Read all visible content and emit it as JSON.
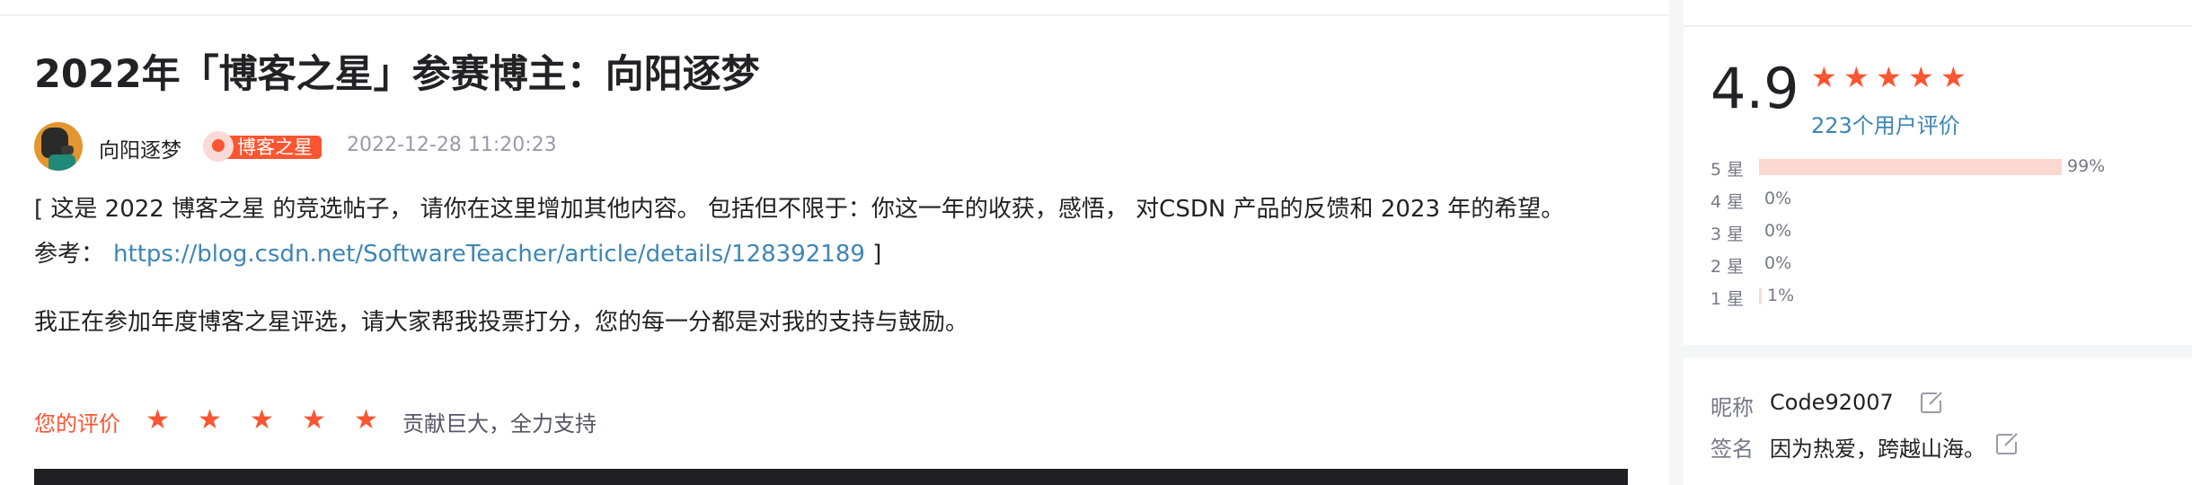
{
  "post": {
    "title": "2022年「博客之星」参赛博主：向阳逐梦",
    "author": "向阳逐梦",
    "badge": "博客之星",
    "date": "2022-12-28 11:20:23",
    "paragraph1": "[ 这是 2022 博客之星 的竞选帖子， 请你在这里增加其他内容。 包括但不限于：你这一年的收获，感悟， 对CSDN 产品的反馈和 2023 年的希望。",
    "reference_label": "参考：",
    "reference_link": "https://blog.csdn.net/SoftwareTeacher/article/details/128392189",
    "reference_suffix": "]",
    "paragraph2": "我正在参加年度博客之星评选，请大家帮我投票打分，您的每一分都是对我的支持与鼓励。"
  },
  "my_rating": {
    "label": "您的评价",
    "stars": 5,
    "comment": "贡献巨大，全力支持"
  },
  "rating_summary": {
    "score": "4.9",
    "stars": 5,
    "review_count": "223个用户评价",
    "distribution": [
      {
        "label": "5 星",
        "fraction": 0.99,
        "percent": "99%"
      },
      {
        "label": "4 星",
        "fraction": 0.0,
        "percent": "0%"
      },
      {
        "label": "3 星",
        "fraction": 0.0,
        "percent": "0%"
      },
      {
        "label": "2 星",
        "fraction": 0.0,
        "percent": "0%"
      },
      {
        "label": "1 星",
        "fraction": 0.01,
        "percent": "1%"
      }
    ]
  },
  "profile": {
    "nickname_label": "昵称",
    "nickname": "Code92007",
    "signature_label": "签名",
    "signature": "因为热爱，跨越山海。"
  },
  "colors": {
    "accent": "#fc5531",
    "link": "#3d86b6",
    "bar_fill": "#fcd8d1"
  },
  "icons": {
    "star": "star-icon",
    "edit": "edit-icon",
    "badge": "medal-icon"
  }
}
